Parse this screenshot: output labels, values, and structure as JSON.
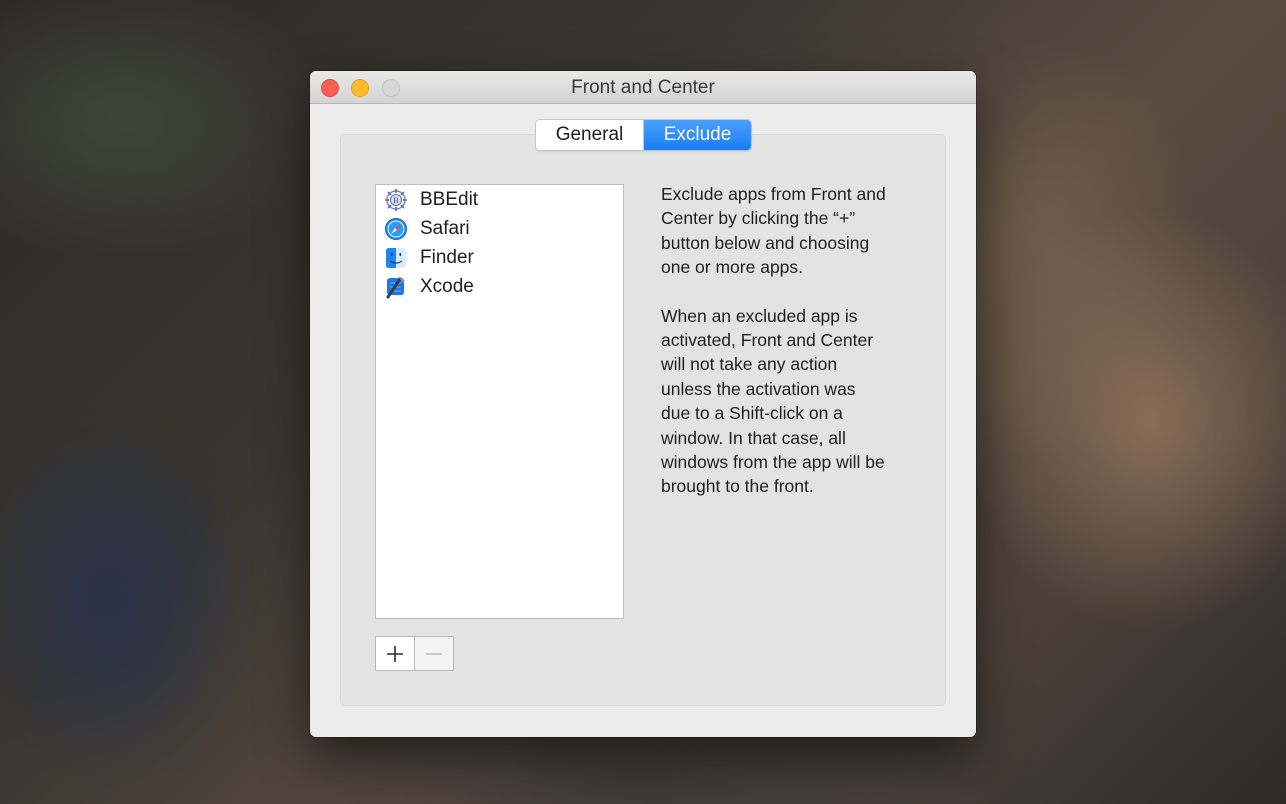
{
  "window": {
    "title": "Front and Center"
  },
  "tabs": [
    {
      "label": "General",
      "selected": false
    },
    {
      "label": "Exclude",
      "selected": true
    }
  ],
  "excluded_apps": [
    {
      "name": "BBEdit",
      "icon": "bbedit-app-icon"
    },
    {
      "name": "Safari",
      "icon": "safari-app-icon"
    },
    {
      "name": "Finder",
      "icon": "finder-app-icon"
    },
    {
      "name": "Xcode",
      "icon": "xcode-app-icon"
    }
  ],
  "buttons": {
    "add": "+",
    "remove": "−"
  },
  "description": {
    "paragraph1": "Exclude apps from Front and\nCenter by clicking the “+”\nbutton below and choosing\none or more apps.",
    "paragraph2": "When an excluded app is\nactivated, Front and Center\nwill not take any action\nunless the activation was\ndue to a Shift-click on a\nwindow. In that case, all\nwindows from the app will be\nbrought to the front."
  },
  "colors": {
    "accent": "#1a7cf3",
    "close": "#fc5f57",
    "minimize": "#fdbc2e",
    "zoom_disabled": "#d8d8d8"
  }
}
